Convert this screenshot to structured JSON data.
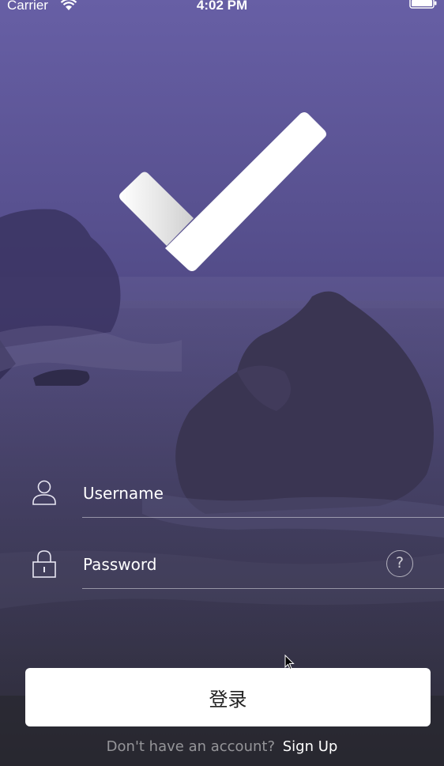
{
  "status_bar": {
    "carrier": "Carrier",
    "time": "4:02 PM",
    "wifi_icon": "wifi-icon",
    "battery_icon": "battery-icon"
  },
  "logo": {
    "icon": "checkmark-logo-icon"
  },
  "form": {
    "username": {
      "placeholder": "Username",
      "value": "",
      "icon": "user-icon"
    },
    "password": {
      "placeholder": "Password",
      "value": "",
      "icon": "lock-icon",
      "help_label": "?"
    }
  },
  "login_button": {
    "label": "登录"
  },
  "signup": {
    "prompt": "Don't have an account?",
    "link": "Sign Up"
  },
  "colors": {
    "sky_top": "#625aa0",
    "sky_mid": "#4d4680",
    "sea_bottom": "#2b2a38",
    "button_bg": "#ffffff",
    "button_text": "#222222"
  }
}
